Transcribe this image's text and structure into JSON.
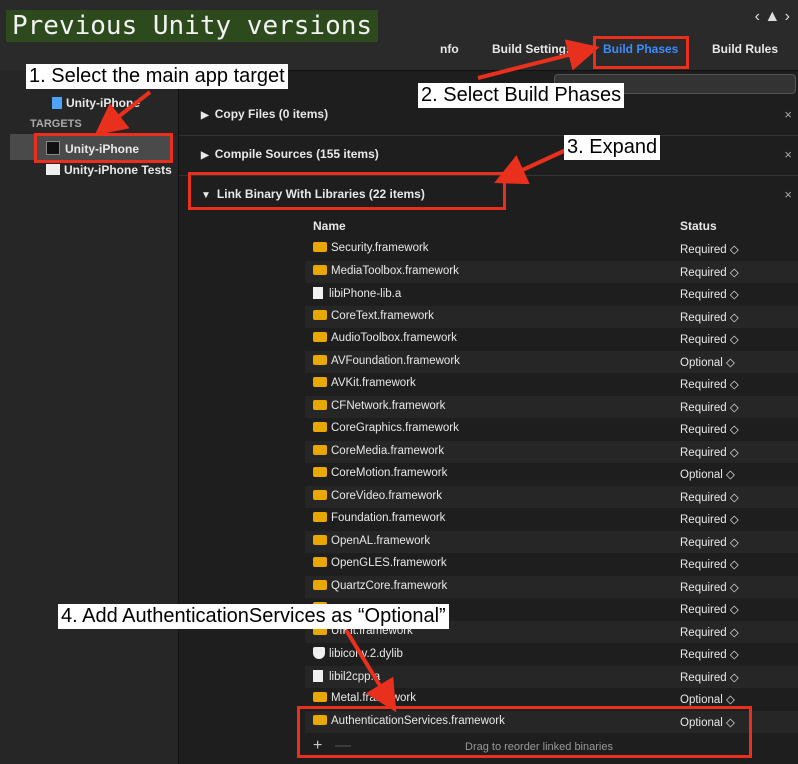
{
  "overlay_title": "Previous Unity versions",
  "toolbar": {
    "nav_glyph": "‹ ▲ ›"
  },
  "tabs": [
    {
      "label": "nfo"
    },
    {
      "label": "Build Settings"
    },
    {
      "label": "Build Phases",
      "active": true
    },
    {
      "label": "Build Rules"
    }
  ],
  "sidebar": {
    "project_item": "Unity-iPhone",
    "targets_header": "TARGETS",
    "targets": [
      {
        "label": "Unity-iPhone"
      },
      {
        "label": "Unity-iPhone Tests"
      }
    ]
  },
  "phases": {
    "copy_files": "Copy Files (0 items)",
    "compile_sources": "Compile Sources (155 items)",
    "link_binary": "Link Binary With Libraries (22 items)",
    "close_glyph": "×"
  },
  "link_table": {
    "header_name": "Name",
    "header_status": "Status",
    "rows": [
      {
        "name": "Security.framework",
        "status": "Required ◇",
        "icon": "framework"
      },
      {
        "name": "MediaToolbox.framework",
        "status": "Required ◇",
        "icon": "framework"
      },
      {
        "name": "libiPhone-lib.a",
        "status": "Required ◇",
        "icon": "file"
      },
      {
        "name": "CoreText.framework",
        "status": "Required ◇",
        "icon": "framework"
      },
      {
        "name": "AudioToolbox.framework",
        "status": "Required ◇",
        "icon": "framework"
      },
      {
        "name": "AVFoundation.framework",
        "status": "Optional ◇",
        "icon": "framework"
      },
      {
        "name": "AVKit.framework",
        "status": "Required ◇",
        "icon": "framework"
      },
      {
        "name": "CFNetwork.framework",
        "status": "Required ◇",
        "icon": "framework"
      },
      {
        "name": "CoreGraphics.framework",
        "status": "Required ◇",
        "icon": "framework"
      },
      {
        "name": "CoreMedia.framework",
        "status": "Required ◇",
        "icon": "framework"
      },
      {
        "name": "CoreMotion.framework",
        "status": "Optional ◇",
        "icon": "framework"
      },
      {
        "name": "CoreVideo.framework",
        "status": "Required ◇",
        "icon": "framework"
      },
      {
        "name": "Foundation.framework",
        "status": "Required ◇",
        "icon": "framework"
      },
      {
        "name": "OpenAL.framework",
        "status": "Required ◇",
        "icon": "framework"
      },
      {
        "name": "OpenGLES.framework",
        "status": "Required ◇",
        "icon": "framework"
      },
      {
        "name": "QuartzCore.framework",
        "status": "Required ◇",
        "icon": "framework"
      },
      {
        "name": "",
        "status": "Required ◇",
        "icon": "framework"
      },
      {
        "name": "UIKit.framework",
        "status": "Required ◇",
        "icon": "framework"
      },
      {
        "name": "libiconv.2.dylib",
        "status": "Required ◇",
        "icon": "shield"
      },
      {
        "name": "libil2cpp.a",
        "status": "Required ◇",
        "icon": "file"
      },
      {
        "name": "Metal.framework",
        "status": "Optional ◇",
        "icon": "framework"
      },
      {
        "name": "AuthenticationServices.framework",
        "status": "Optional ◇",
        "icon": "framework"
      }
    ],
    "footer_plus": "+",
    "footer_minus": "—",
    "footer_hint": "Drag to reorder linked binaries"
  },
  "annotations": {
    "step1": "1. Select the main app target",
    "step2": "2. Select Build Phases",
    "step3": "3. Expand",
    "step4": "4. Add AuthenticationServices as “Optional”"
  },
  "colors": {
    "annotation_red": "#e8301c",
    "active_tab": "#3d8cff",
    "title_bg": "#2c4a1c"
  }
}
